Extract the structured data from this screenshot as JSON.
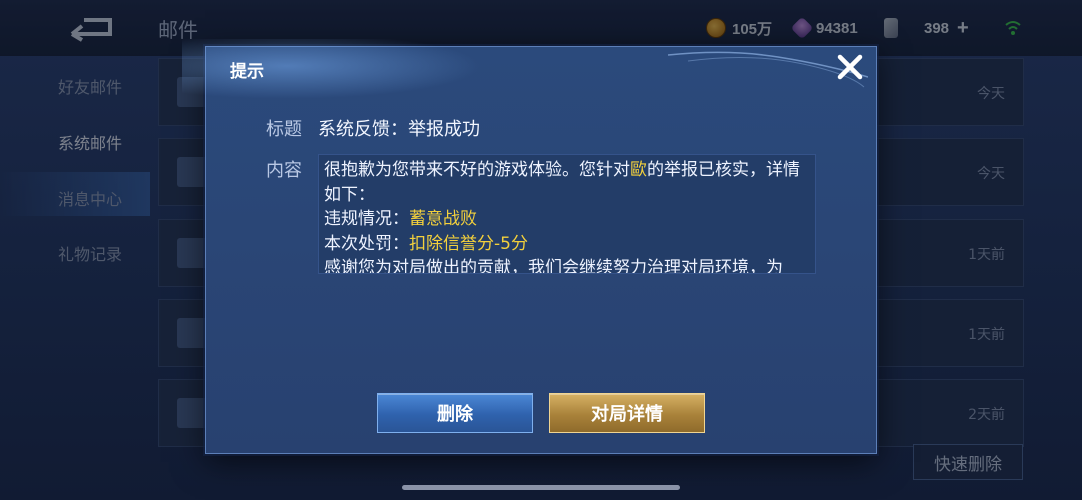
{
  "background": {
    "page_title": "邮件",
    "resources": {
      "coins": "105万",
      "gems": "94381",
      "tickets": "398",
      "tickets_plus": "+"
    },
    "nav": [
      {
        "label": "好友邮件"
      },
      {
        "label": "系统邮件"
      },
      {
        "label": "消息中心"
      },
      {
        "label": "礼物记录"
      }
    ],
    "mails": [
      {
        "time": "今天"
      },
      {
        "time": "今天"
      },
      {
        "time": "1天前"
      },
      {
        "time": "1天前"
      },
      {
        "time": "2天前"
      }
    ],
    "quick_delete_label": "快速删除"
  },
  "modal": {
    "title": "提示",
    "subject_label": "标题",
    "subject": "系统反馈：举报成功",
    "content_label": "内容",
    "content": {
      "line1_pre": "很抱歉为您带来不好的游戏体验。您针对",
      "line1_player": "歐",
      "line1_post": "的举报已核实，详情如下：",
      "violation_label": "违规情况：",
      "violation_value": "蓄意战败",
      "penalty_label": "本次处罚：",
      "penalty_value": "扣除信誉分-5分",
      "line4": "感谢您为对局做出的贡献，我们会继续努力治理对局环境，为"
    },
    "delete_label": "删除",
    "match_detail_label": "对局详情",
    "colors": {
      "highlight": "#f3d03c",
      "delete_button": "#3a70bf",
      "detail_button": "#b48c44"
    }
  }
}
